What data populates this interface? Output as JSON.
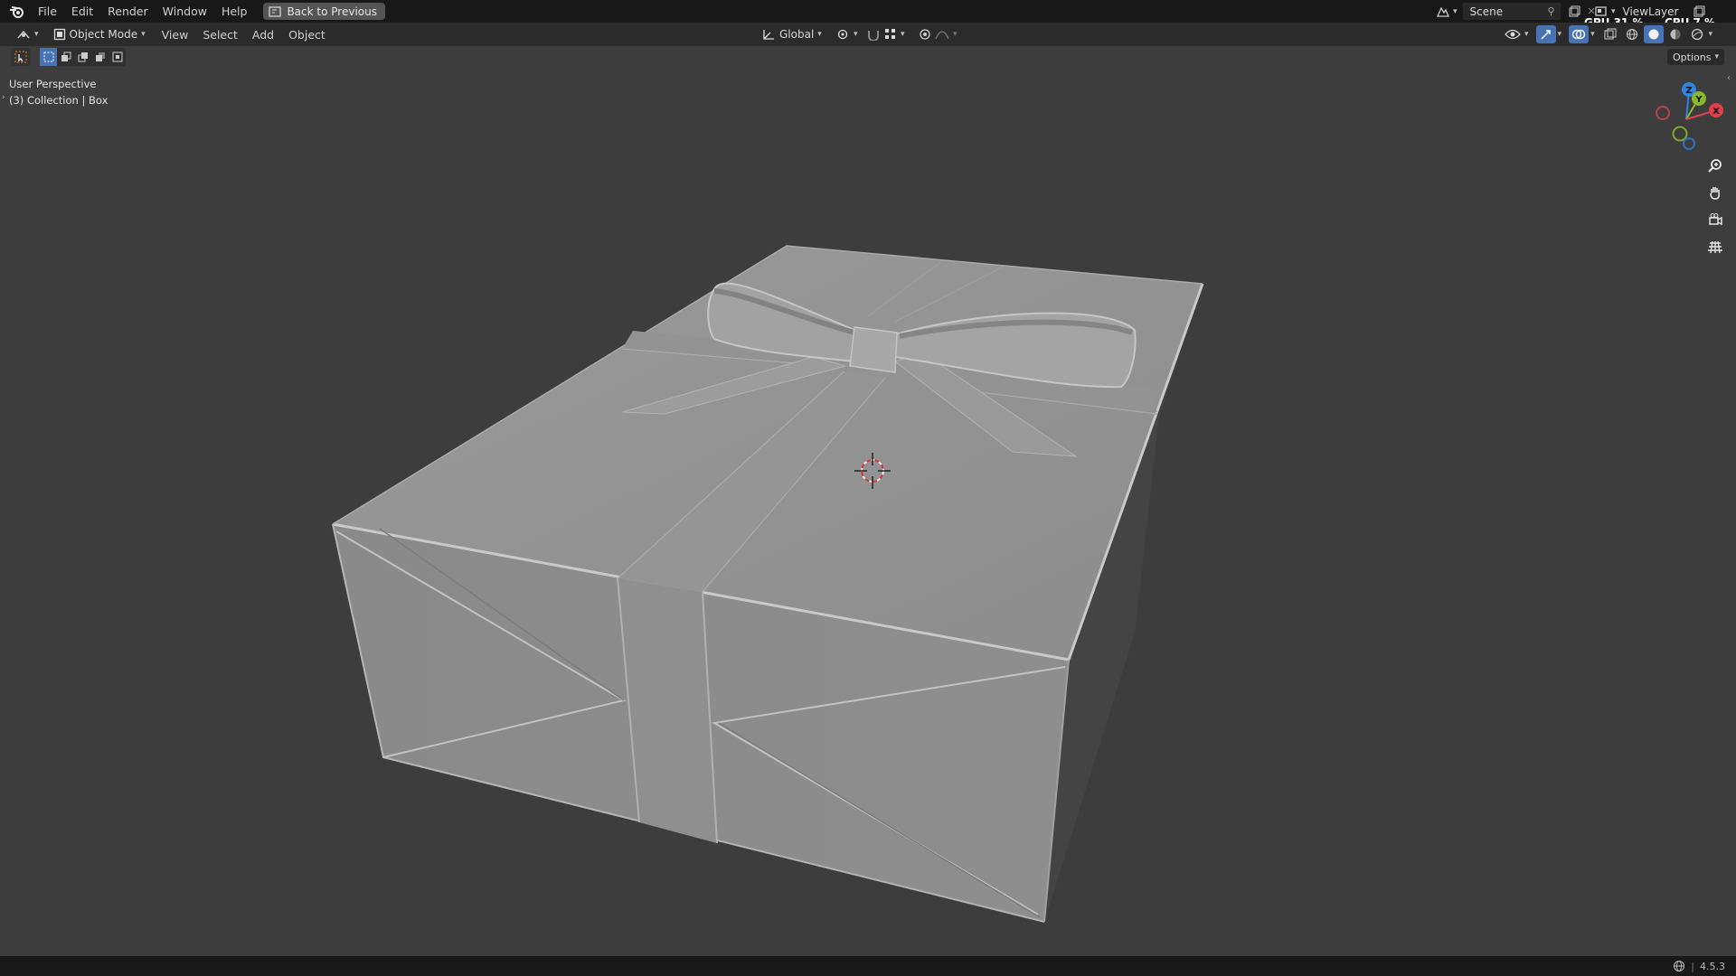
{
  "topbar": {
    "menus": [
      "File",
      "Edit",
      "Render",
      "Window",
      "Help"
    ],
    "back_label": "Back to Previous",
    "scene_label": "Scene",
    "viewlayer_label": "ViewLayer",
    "gpu_label": "GPU 31 %",
    "cpu_label": "CPU 7 %"
  },
  "header": {
    "mode_label": "Object Mode",
    "menus": [
      "View",
      "Select",
      "Add",
      "Object"
    ],
    "orientation_label": "Global",
    "options_label": "Options"
  },
  "viewport": {
    "perspective_label": "User Perspective",
    "collection_label": "(3) Collection | Box",
    "gizmo_axes": [
      "Z",
      "Y",
      "X"
    ]
  },
  "status": {
    "version": "4.5.3"
  },
  "colors": {
    "axis_x": "#e2404f",
    "axis_y": "#8ab82b",
    "axis_z": "#2f84e3",
    "accent": "#4772b3",
    "viewport_bg": "#3d3d3d"
  },
  "icons": [
    "blender-logo",
    "back-icon",
    "scene-icon",
    "viewlayer-icon",
    "editor-type-icon",
    "object-mode-icon",
    "transform-orientation-icon",
    "pivot-icon",
    "snap-icon",
    "proportional-icon",
    "visibility-icon",
    "gizmo-icon",
    "overlay-icon",
    "xray-icon",
    "wireframe-shading-icon",
    "solid-shading-icon",
    "material-shading-icon",
    "rendered-shading-icon",
    "zoom-icon",
    "pan-icon",
    "camera-icon",
    "grid-icon",
    "select-box-icon",
    "network-icon"
  ]
}
